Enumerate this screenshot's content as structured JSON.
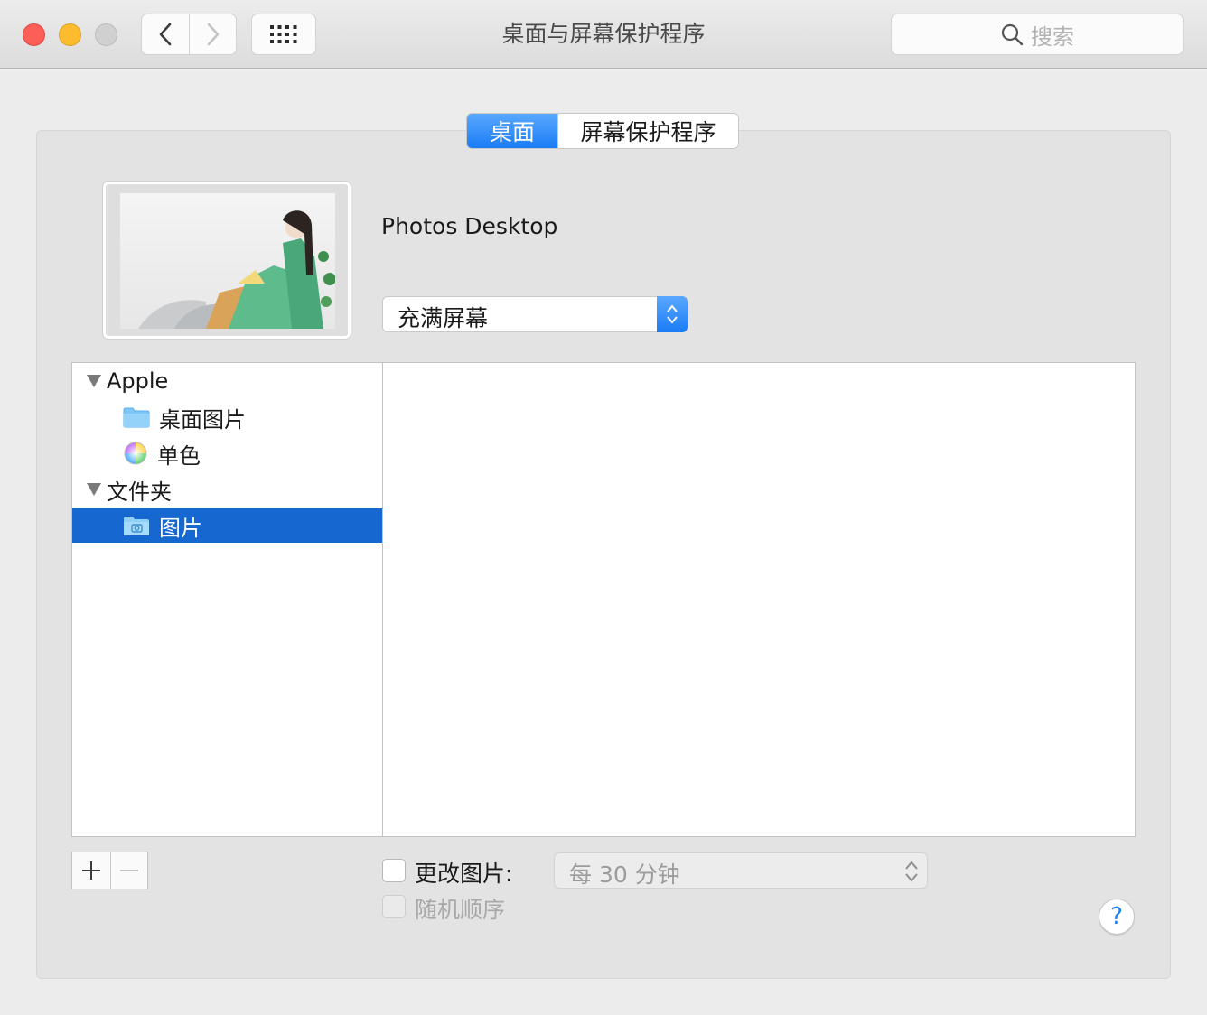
{
  "window": {
    "title": "桌面与屏幕保护程序"
  },
  "search": {
    "placeholder": "搜索",
    "icon": "magnifier-icon"
  },
  "tabs": [
    {
      "label": "桌面",
      "active": true
    },
    {
      "label": "屏幕保护程序",
      "active": false
    }
  ],
  "current_picture": {
    "name": "Photos Desktop"
  },
  "fit_popup": {
    "value": "充满屏幕"
  },
  "sidebar": {
    "groups": [
      {
        "label": "Apple",
        "expanded": true,
        "items": [
          {
            "label": "桌面图片",
            "icon": "folder-icon"
          },
          {
            "label": "单色",
            "icon": "color-wheel-icon"
          }
        ]
      },
      {
        "label": "文件夹",
        "expanded": true,
        "items": [
          {
            "label": "图片",
            "icon": "photos-folder-icon",
            "selected": true
          }
        ]
      }
    ]
  },
  "controls": {
    "add_label": "+",
    "remove_label": "−",
    "change_picture_label": "更改图片:",
    "change_picture_checked": false,
    "interval_value": "每 30 分钟",
    "random_order_label": "随机顺序",
    "random_order_enabled": false,
    "help_label": "?"
  },
  "colors": {
    "accent": "#1b7cf5",
    "selection": "#1767d1"
  }
}
